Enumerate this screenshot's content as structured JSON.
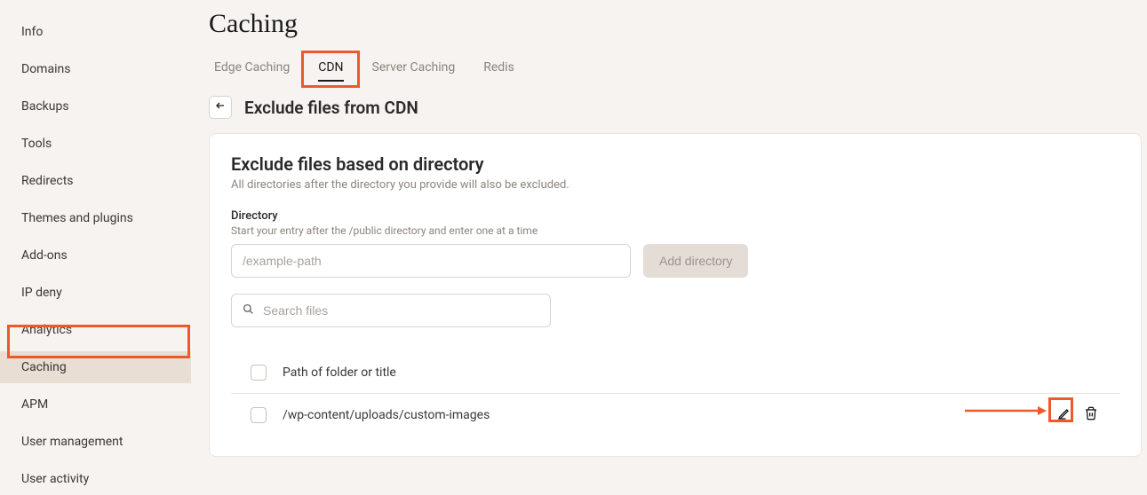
{
  "sidebar": {
    "items": [
      {
        "label": "Info"
      },
      {
        "label": "Domains"
      },
      {
        "label": "Backups"
      },
      {
        "label": "Tools"
      },
      {
        "label": "Redirects"
      },
      {
        "label": "Themes and plugins"
      },
      {
        "label": "Add-ons"
      },
      {
        "label": "IP deny"
      },
      {
        "label": "Analytics"
      },
      {
        "label": "Caching"
      },
      {
        "label": "APM"
      },
      {
        "label": "User management"
      },
      {
        "label": "User activity"
      }
    ],
    "active_index": 9
  },
  "page": {
    "title": "Caching",
    "subhead": "Exclude files from CDN"
  },
  "tabs": {
    "items": [
      {
        "label": "Edge Caching"
      },
      {
        "label": "CDN"
      },
      {
        "label": "Server Caching"
      },
      {
        "label": "Redis"
      }
    ],
    "active_index": 1
  },
  "card": {
    "title": "Exclude files based on directory",
    "subtitle": "All directories after the directory you provide will also be excluded.",
    "dir_label": "Directory",
    "dir_hint": "Start your entry after the /public directory and enter one at a time",
    "dir_placeholder": "/example-path",
    "add_label": "Add directory",
    "search_placeholder": "Search files",
    "header_label": "Path of folder or title",
    "rows": [
      {
        "path": "/wp-content/uploads/custom-images"
      }
    ]
  }
}
